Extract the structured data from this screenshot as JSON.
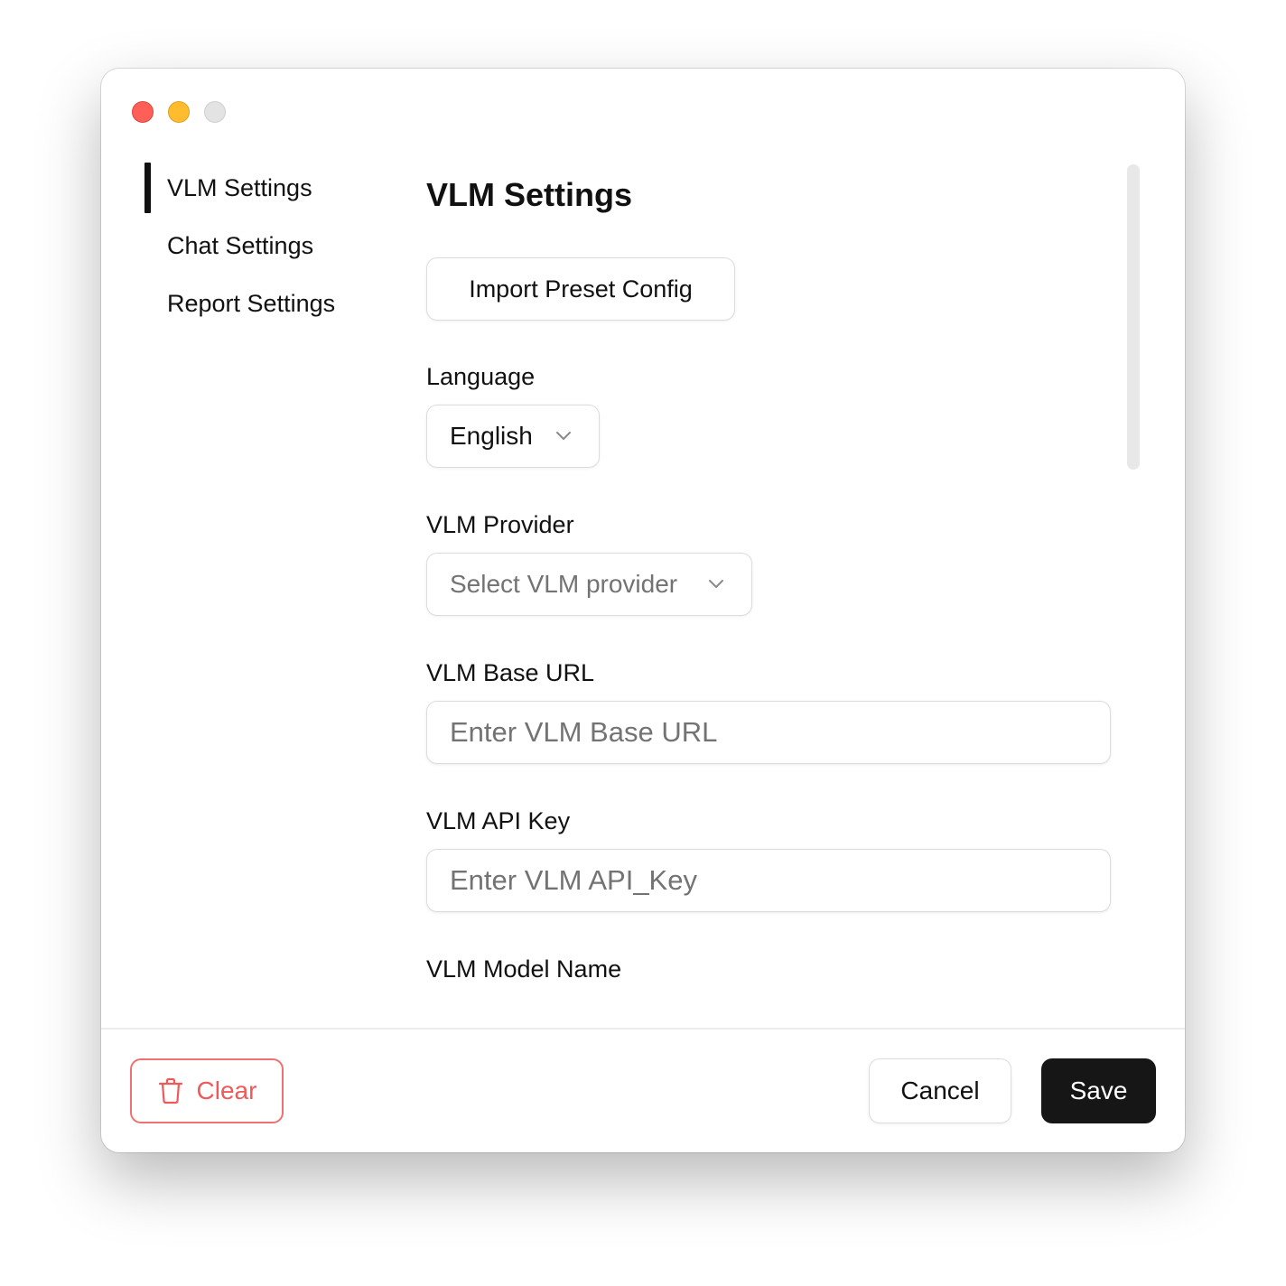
{
  "window": {
    "traffic_lights": [
      "close",
      "minimize",
      "zoom"
    ]
  },
  "sidebar": {
    "items": [
      {
        "label": "VLM Settings",
        "active": true
      },
      {
        "label": "Chat Settings",
        "active": false
      },
      {
        "label": "Report Settings",
        "active": false
      }
    ]
  },
  "main": {
    "title": "VLM Settings",
    "import_button": "Import Preset Config",
    "language": {
      "label": "Language",
      "value": "English"
    },
    "provider": {
      "label": "VLM Provider",
      "placeholder": "Select VLM provider"
    },
    "base_url": {
      "label": "VLM Base URL",
      "placeholder": "Enter VLM Base URL"
    },
    "api_key": {
      "label": "VLM API Key",
      "placeholder": "Enter VLM API_Key"
    },
    "model_name": {
      "label": "VLM Model Name"
    }
  },
  "footer": {
    "clear": "Clear",
    "cancel": "Cancel",
    "save": "Save"
  },
  "colors": {
    "accent": "#161616",
    "danger": "#ee5a5a",
    "close": "#fe5f57",
    "minimize": "#febc2e",
    "zoom": "#e3e3e3"
  },
  "icons": [
    "chevron-down-icon",
    "trash-icon"
  ]
}
